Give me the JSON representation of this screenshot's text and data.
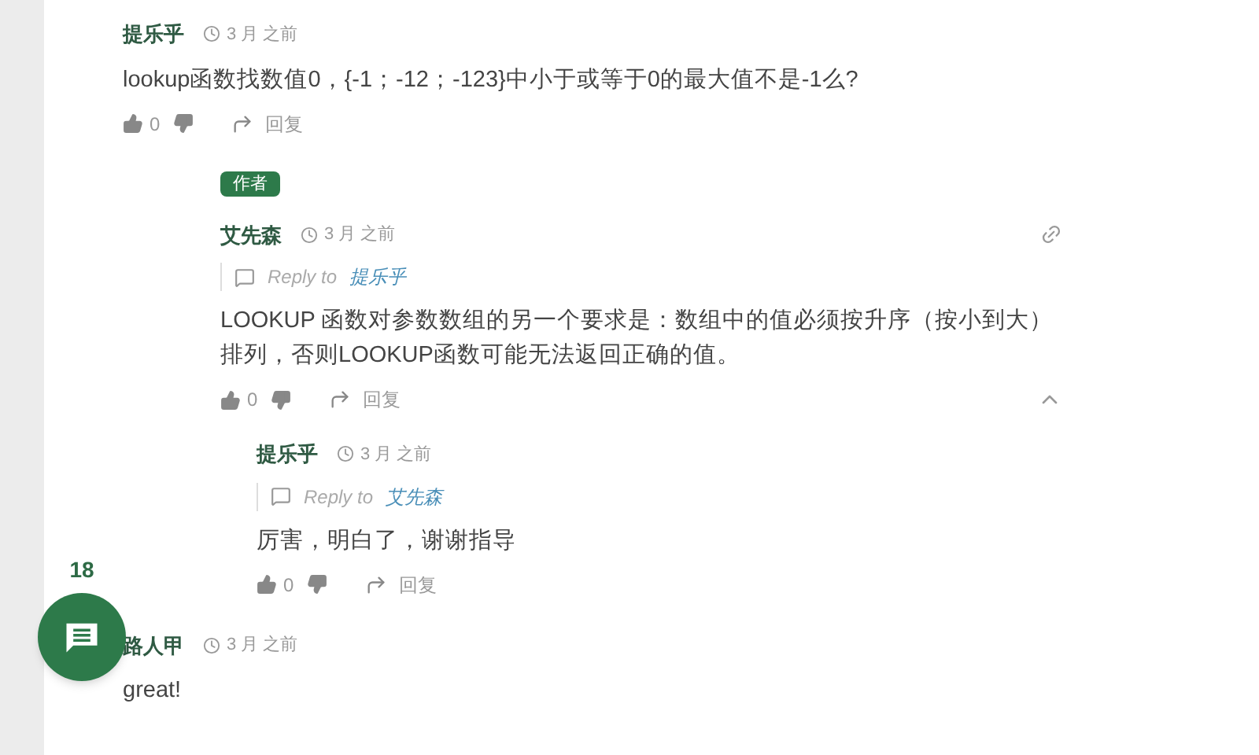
{
  "comments": [
    {
      "author": "提乐乎",
      "time": "3 月 之前",
      "text": "lookup函数找数值0，{-1；-12；-123}中小于或等于0的最大值不是-1么?",
      "likes": "0",
      "reply_label": "回复",
      "children": [
        {
          "badge": "作者",
          "author": "艾先森",
          "time": "3 月 之前",
          "has_link": true,
          "reply_prefix": "Reply to",
          "reply_to": "提乐乎",
          "text": "LOOKUP 函数对参数数组的另一个要求是：数组中的值必须按升序（按小到大）排列，否则LOOKUP函数可能无法返回正确的值。",
          "likes": "0",
          "reply_label": "回复",
          "expanded": true,
          "children": [
            {
              "author": "提乐乎",
              "time": "3 月 之前",
              "reply_prefix": "Reply to",
              "reply_to": "艾先森",
              "text": "厉害，明白了，谢谢指导",
              "likes": "0",
              "reply_label": "回复"
            }
          ]
        }
      ]
    },
    {
      "author": "路人甲",
      "time": "3 月 之前",
      "text": "great!"
    }
  ],
  "fab": {
    "count": "18"
  }
}
